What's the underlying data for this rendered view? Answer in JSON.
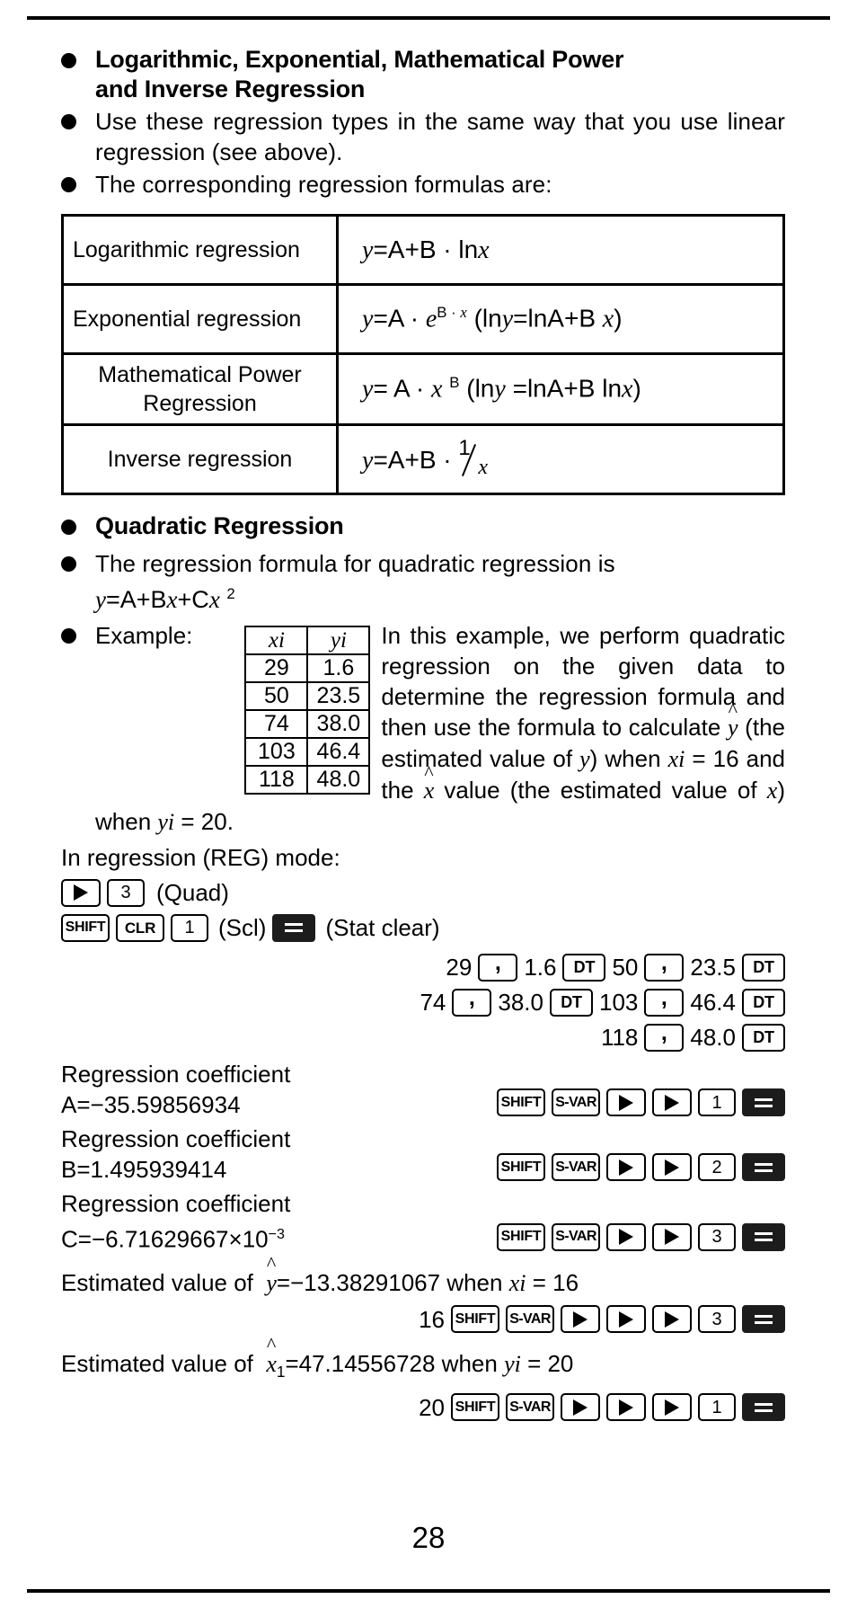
{
  "page": {
    "number": "28"
  },
  "section1": {
    "heading_line1": "Logarithmic,  Exponential,  Mathematical  Power",
    "heading_line2": "and Inverse Regression",
    "bullet2": "Use these regression types in the same way that you use  linear regression (see above).",
    "bullet3": "The corresponding regression formulas are:"
  },
  "formula_table": {
    "rows": [
      {
        "label": "Logarithmic regression",
        "formula_plain": "y=A+B · ln x"
      },
      {
        "label": "Exponential regression",
        "formula_plain": "y=A · e^(B · x) (ln y=lnA+B x)"
      },
      {
        "label_line1": "Mathematical Power",
        "label_line2": "Regression",
        "formula_plain": "y= A · x^B (ln y =lnA+B ln x)"
      },
      {
        "label": "Inverse regression",
        "formula_plain": "y=A+B · 1/x"
      }
    ]
  },
  "section2": {
    "heading": "Quadratic Regression",
    "bullet1": "The regression formula for quadratic regression is",
    "formula_plain": "y=A+Bx+Cx²",
    "example_label": "Example:",
    "example_text": "In this example, we perform quadratic regression on the given data to determine the regression formula and then use the formula to calculate ŷ (the estimated value of y) when xi = 16 and the x̂ value (the estimated value of x) when yi = 20."
  },
  "data_table": {
    "headers": [
      "xi",
      "yi"
    ],
    "rows": [
      [
        "29",
        "1.6"
      ],
      [
        "50",
        "23.5"
      ],
      [
        "74",
        "38.0"
      ],
      [
        "103",
        "46.4"
      ],
      [
        "118",
        "48.0"
      ]
    ]
  },
  "procedure": {
    "mode_line": "In regression (REG) mode:",
    "quad_label": "(Quad)",
    "scl_label": "(Scl)",
    "stat_clear_label": "(Stat clear)",
    "key_labels": {
      "shift": "SHIFT",
      "clr": "CLR",
      "svar": "S-VAR",
      "dt": "DT",
      "one": "1",
      "two": "2",
      "three": "3",
      "comma": ","
    },
    "entry_rows": [
      {
        "items": [
          "29",
          "KEY_COMMA",
          "1.6",
          "KEY_DT",
          "50",
          "KEY_COMMA",
          "23.5",
          "KEY_DT"
        ]
      },
      {
        "items": [
          "74",
          "KEY_COMMA",
          "38.0",
          "KEY_DT",
          "103",
          "KEY_COMMA",
          "46.4",
          "KEY_DT"
        ]
      },
      {
        "items": [
          "118",
          "KEY_COMMA",
          "48.0",
          "KEY_DT"
        ]
      }
    ],
    "entry_values": {
      "r1_n1": "29",
      "r1_n2": "1.6",
      "r1_n3": "50",
      "r1_n4": "23.5",
      "r2_n1": "74",
      "r2_n2": "38.0",
      "r2_n3": "103",
      "r2_n4": "46.4",
      "r3_n1": "118",
      "r3_n2": "48.0"
    }
  },
  "results": {
    "coefficient_label": "Regression coefficient",
    "a_value": "A=−35.59856934",
    "b_value": "B=1.495939414",
    "c_value_base": "C=−6.71629667×10",
    "c_value_exp": "−3",
    "estimated_y": {
      "prefix": "Estimated value of",
      "body": "=−13.38291067 when",
      "condition": "= 16",
      "input": "16"
    },
    "estimated_x": {
      "prefix": "Estimated value of",
      "body": "=47.14556728 when",
      "condition": "= 20",
      "input": "20"
    }
  }
}
